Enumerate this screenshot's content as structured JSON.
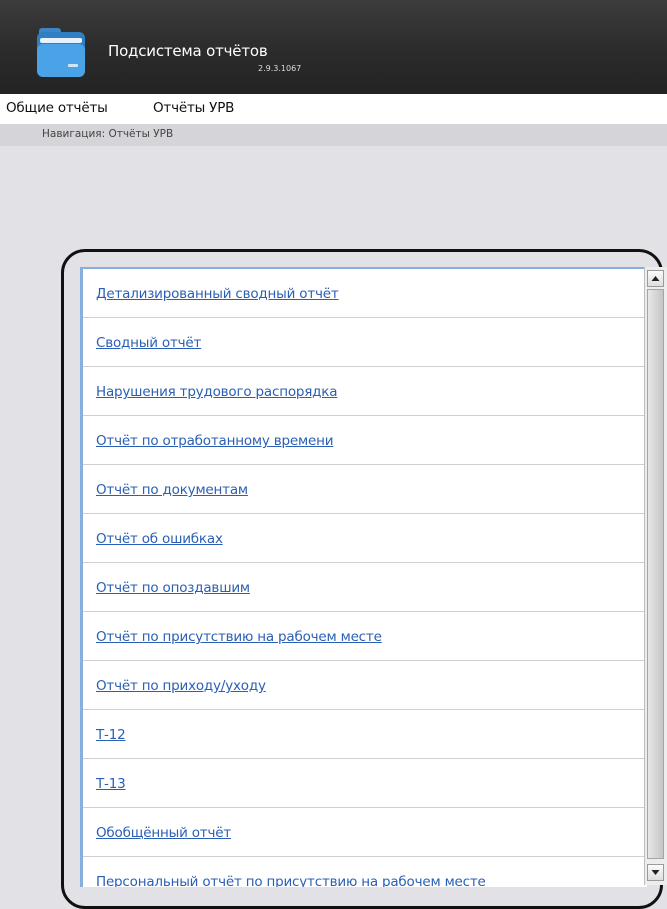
{
  "header": {
    "title": "Подсистема отчётов",
    "version": "2.9.3.1067",
    "icon": "folder-icon"
  },
  "menu": {
    "items": [
      "Общие отчёты",
      "Отчёты УРВ"
    ]
  },
  "breadcrumb": "Навигация: Отчёты УРВ",
  "reports": [
    "Детализированный сводный отчёт",
    "Сводный отчёт",
    "Нарушения трудового распорядка",
    "Отчёт по отработанному времени",
    "Отчёт по документам",
    "Отчёт об ошибках",
    "Отчёт по опоздавшим",
    "Отчёт по присутствию на рабочем месте",
    "Отчёт по приходу/уходу",
    "Т-12",
    "Т-13",
    "Обобщённый отчёт",
    "Персональный отчёт по присутствию на рабочем месте"
  ],
  "colors": {
    "header_bg": "#2b2b2b",
    "link": "#2a5fb5",
    "list_accent": "#86aee0",
    "page_bg": "#e1e1e6"
  }
}
